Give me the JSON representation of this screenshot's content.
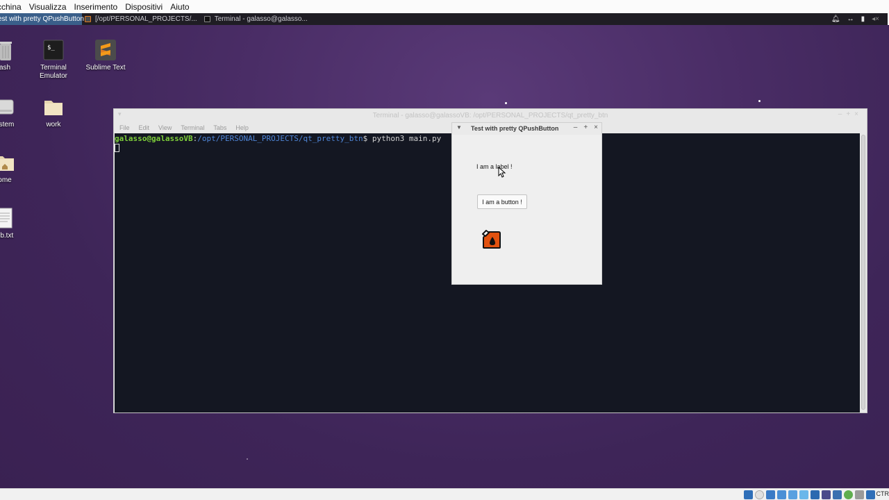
{
  "host_menu": [
    "cchina",
    "Visualizza",
    "Inserimento",
    "Dispositivi",
    "Aiuto"
  ],
  "taskbar": {
    "tasks": [
      {
        "label": "est with pretty QPushButton",
        "active": true
      },
      {
        "label": "[/opt/PERSONAL_PROJECTS/...",
        "active": false
      },
      {
        "label": "Terminal - galasso@galasso...",
        "active": false
      }
    ],
    "tray_icons": [
      "bell-icon",
      "network-icon",
      "battery-icon",
      "volume-icon"
    ]
  },
  "desktop_icons": {
    "trash": "ash",
    "terminal_line1": "Terminal",
    "terminal_line2": "Emulator",
    "sublime": "Sublime Text",
    "filesystem": "ystem",
    "work": "work",
    "home": "ome",
    "txt": "ub.txt"
  },
  "terminal": {
    "title": "Terminal - galasso@galassoVB: /opt/PERSONAL_PROJECTS/qt_pretty_btn",
    "menu": [
      "File",
      "Edit",
      "View",
      "Terminal",
      "Tabs",
      "Help"
    ],
    "prompt_user": "galasso@galassoVB",
    "prompt_colon": ":",
    "prompt_path": "/opt/PERSONAL_PROJECTS/qt_pretty_btn",
    "prompt_dollar": "$ ",
    "command": "python3 main.py"
  },
  "qt_window": {
    "title": "Test with pretty QPushButton",
    "label_text": "I am a label !",
    "button_text": "I am a button !",
    "image_icon": "fuel-can-icon"
  },
  "status_bar": {
    "host_key": "CTR"
  },
  "colors": {
    "desktop": "#4a2d66",
    "terminal_bg": "#141722",
    "prompt_user": "#7ecf3a",
    "prompt_path": "#4f86d8",
    "taskbar_active": "#3a5f8a",
    "fuel_can": "#e2520f"
  }
}
